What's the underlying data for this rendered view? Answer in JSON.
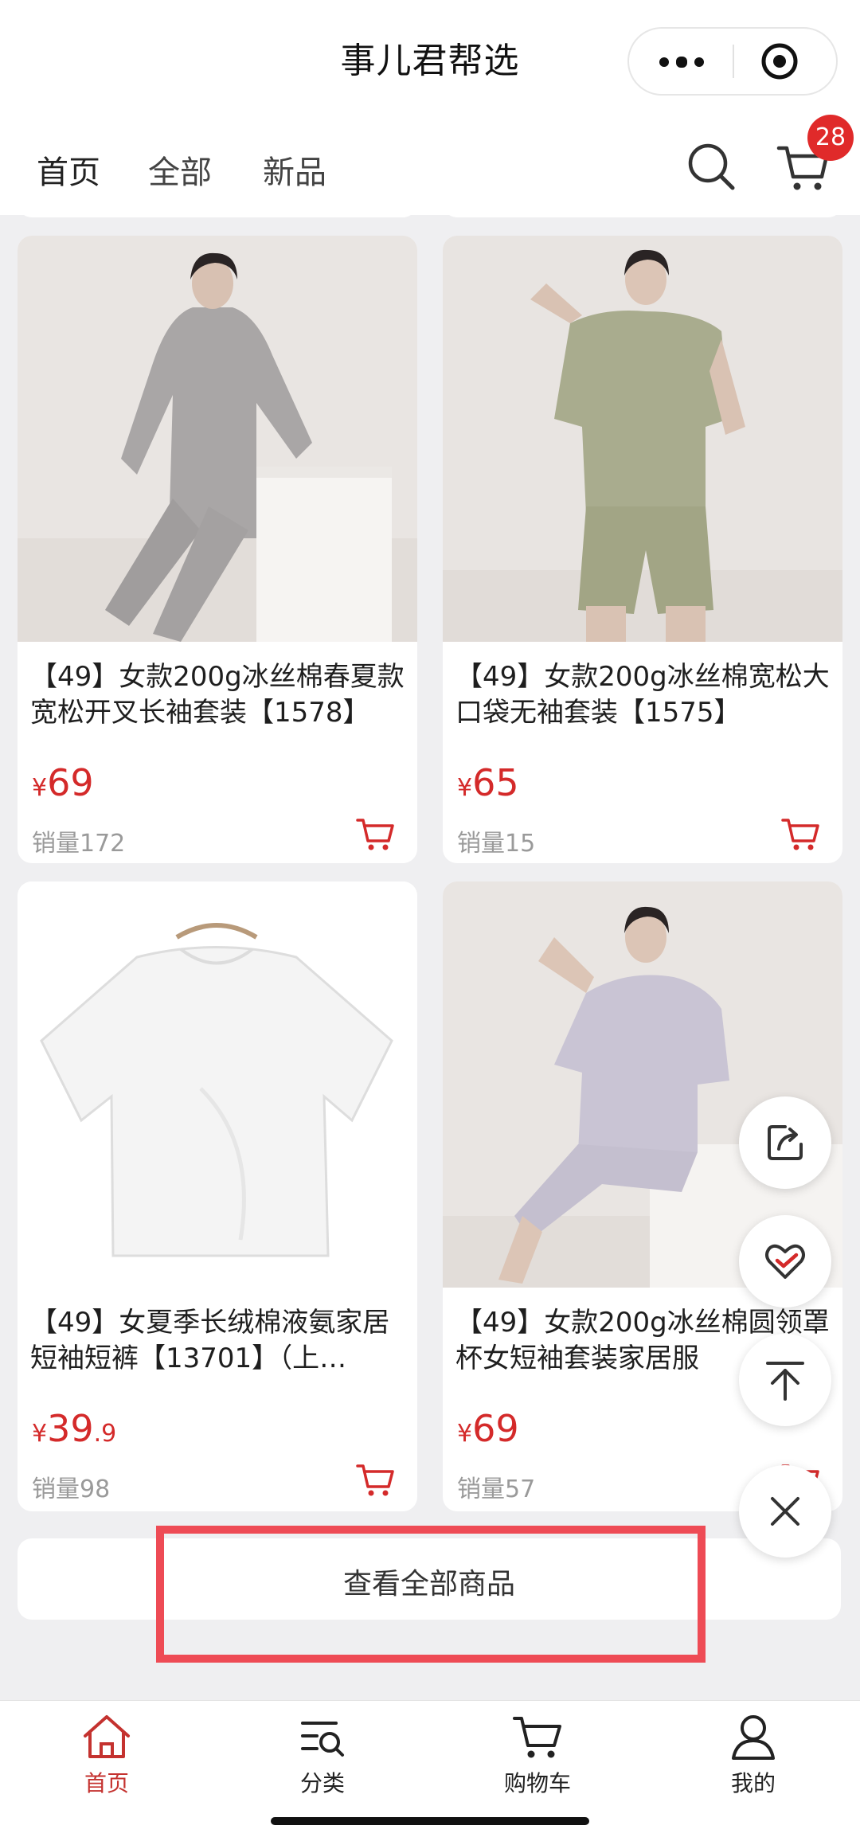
{
  "header": {
    "title": "事儿君帮选"
  },
  "tabs": [
    {
      "label": "首页"
    },
    {
      "label": "全部"
    },
    {
      "label": "新品"
    }
  ],
  "cart_count": "28",
  "products": [
    {
      "title": "【49】女款200g冰丝棉春夏款宽松开叉长袖套装【1578】",
      "currency": "¥",
      "price_int": "69",
      "price_dec": "",
      "sales": "销量172"
    },
    {
      "title": "【49】女款200g冰丝棉宽松大口袋无袖套装【1575】",
      "currency": "¥",
      "price_int": "65",
      "price_dec": "",
      "sales": "销量15"
    },
    {
      "title": "【49】女夏季长绒棉液氨家居短袖短裤【13701】（上…",
      "currency": "¥",
      "price_int": "39",
      "price_dec": ".9",
      "sales": "销量98"
    },
    {
      "title": "【49】女款200g冰丝棉圆领罩杯女短袖套装家居服",
      "currency": "¥",
      "price_int": "69",
      "price_dec": "",
      "sales": "销量57"
    }
  ],
  "view_all_label": "查看全部商品",
  "bottom_nav": [
    {
      "label": "首页"
    },
    {
      "label": "分类"
    },
    {
      "label": "购物车"
    },
    {
      "label": "我的"
    }
  ],
  "icons": {
    "more": "more-dots-icon",
    "capsule_close": "target-icon",
    "search": "search-icon",
    "cart": "cart-icon",
    "share": "share-icon",
    "favorite": "heart-check-icon",
    "top": "back-to-top-icon",
    "close": "close-icon"
  },
  "colors": {
    "accent": "#cf2f2f",
    "price": "#d42a2a",
    "highlight": "#ee4b55",
    "background": "#efeff1"
  }
}
